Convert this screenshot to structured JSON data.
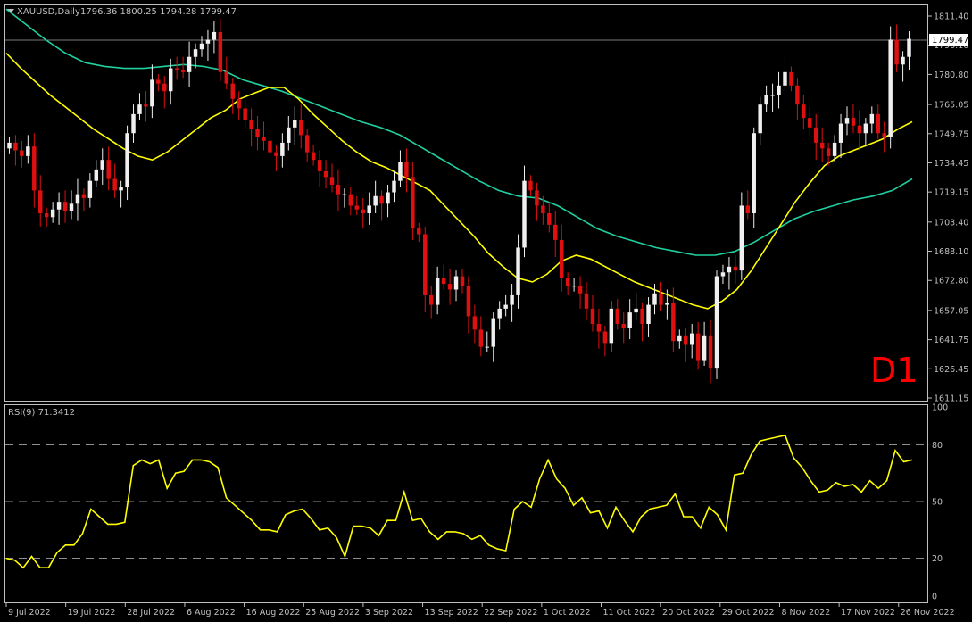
{
  "header": {
    "symbol": "XAUUSD,Daily",
    "ohlc": "1796.36 1800.25 1794.28 1799.47"
  },
  "timeframe_label": "D1",
  "price_axis": {
    "ticks": [
      "1811.40",
      "1796.10",
      "1780.80",
      "1765.05",
      "1749.75",
      "1734.45",
      "1719.15",
      "1703.40",
      "1688.10",
      "1672.80",
      "1657.05",
      "1641.75",
      "1626.45",
      "1611.15"
    ],
    "current_price_label": "1799.47"
  },
  "rsi": {
    "label": "RSI(9) 71.3412",
    "ticks": [
      "100",
      "80",
      "50",
      "20",
      "0"
    ]
  },
  "date_axis": {
    "ticks": [
      "9 Jul 2022",
      "19 Jul 2022",
      "28 Jul 2022",
      "6 Aug 2022",
      "16 Aug 2022",
      "25 Aug 2022",
      "3 Sep 2022",
      "13 Sep 2022",
      "22 Sep 2022",
      "1 Oct 2022",
      "11 Oct 2022",
      "20 Oct 2022",
      "29 Oct 2022",
      "8 Nov 2022",
      "17 Nov 2022",
      "26 Nov 2022"
    ]
  },
  "colors": {
    "background": "#000000",
    "bull_candle": "#f0f0f0",
    "bear_candle": "#e01010",
    "ma_fast": "#ffff00",
    "ma_slow": "#20d0a0",
    "rsi_line": "#ffff00",
    "timeframe_label": "#ff0000",
    "grid_dash": "#c0c0c0",
    "axis_text": "#c0c0c0"
  },
  "chart_data": {
    "type": "candlestick",
    "title": "XAUUSD,Daily",
    "ylim": [
      1611.15,
      1811.4
    ],
    "candle_closes": [
      1745,
      1741,
      1738,
      1743,
      1720,
      1708,
      1706,
      1710,
      1714,
      1709,
      1713,
      1718,
      1716,
      1725,
      1731,
      1736,
      1726,
      1720,
      1722,
      1750,
      1760,
      1765,
      1764,
      1778,
      1776,
      1772,
      1784,
      1783,
      1782,
      1790,
      1794,
      1797,
      1799,
      1803,
      1782,
      1776,
      1768,
      1763,
      1757,
      1752,
      1748,
      1746,
      1740,
      1738,
      1745,
      1753,
      1757,
      1749,
      1740,
      1736,
      1730,
      1727,
      1723,
      1718,
      1718,
      1712,
      1710,
      1708,
      1712,
      1717,
      1713,
      1719,
      1725,
      1735,
      1727,
      1700,
      1697,
      1665,
      1660,
      1674,
      1671,
      1668,
      1675,
      1670,
      1654,
      1647,
      1638,
      1638,
      1653,
      1658,
      1660,
      1665,
      1690,
      1725,
      1720,
      1712,
      1708,
      1702,
      1694,
      1674,
      1670,
      1670,
      1666,
      1658,
      1650,
      1646,
      1640,
      1658,
      1650,
      1648,
      1656,
      1658,
      1650,
      1660,
      1666,
      1660,
      1661,
      1641,
      1644,
      1639,
      1645,
      1631,
      1644,
      1627,
      1675,
      1677,
      1680,
      1678,
      1712,
      1708,
      1750,
      1765,
      1770,
      1770,
      1775,
      1782,
      1775,
      1765,
      1758,
      1753,
      1745,
      1742,
      1738,
      1745,
      1755,
      1758,
      1754,
      1750,
      1755,
      1760,
      1750,
      1748,
      1799,
      1786,
      1790,
      1799.47
    ],
    "ma_fast_values": [
      1792,
      1784,
      1777,
      1770,
      1764,
      1758,
      1752,
      1747,
      1742,
      1738,
      1736,
      1740,
      1746,
      1752,
      1758,
      1762,
      1768,
      1771,
      1774,
      1774,
      1768,
      1760,
      1753,
      1746,
      1740,
      1735,
      1732,
      1728,
      1724,
      1720,
      1712,
      1704,
      1696,
      1687,
      1680,
      1674,
      1672,
      1676,
      1683,
      1686,
      1684,
      1680,
      1676,
      1672,
      1669,
      1666,
      1663,
      1660,
      1658,
      1662,
      1668,
      1678,
      1690,
      1702,
      1714,
      1724,
      1733,
      1738,
      1741,
      1744,
      1747,
      1752,
      1756
    ],
    "ma_slow_values": [
      1815,
      1807,
      1799,
      1792,
      1787,
      1785,
      1784,
      1784,
      1785,
      1786,
      1785,
      1783,
      1778,
      1775,
      1772,
      1768,
      1764,
      1760,
      1756,
      1753,
      1749,
      1743,
      1737,
      1731,
      1725,
      1720,
      1717,
      1716,
      1712,
      1706,
      1700,
      1696,
      1693,
      1690,
      1688,
      1686,
      1686,
      1688,
      1693,
      1699,
      1705,
      1709,
      1712,
      1715,
      1717,
      1720,
      1726
    ],
    "rsi_values": [
      20,
      19,
      15,
      21,
      15,
      15,
      23,
      27,
      27,
      33,
      46,
      42,
      38,
      38,
      39,
      69,
      72,
      70,
      72,
      57,
      65,
      66,
      72,
      72,
      71,
      68,
      52,
      48,
      44,
      40,
      35,
      35,
      34,
      43,
      45,
      46,
      41,
      35,
      36,
      31,
      21,
      37,
      37,
      36,
      32,
      40,
      40,
      55,
      40,
      41,
      34,
      30,
      34,
      34,
      33,
      30,
      32,
      27,
      25,
      24,
      46,
      50,
      47,
      62,
      72,
      62,
      57,
      48,
      52,
      44,
      45,
      36,
      47,
      40,
      34,
      42,
      46,
      47,
      48,
      54,
      42,
      42,
      36,
      47,
      43,
      35,
      64,
      65,
      75,
      82,
      83,
      84,
      85,
      73,
      68,
      61,
      55,
      56,
      60,
      58,
      59,
      55,
      61,
      57,
      61,
      77,
      71,
      72
    ],
    "rsi_levels": [
      80,
      50,
      20
    ],
    "rsi_ylim": [
      0,
      100
    ]
  }
}
